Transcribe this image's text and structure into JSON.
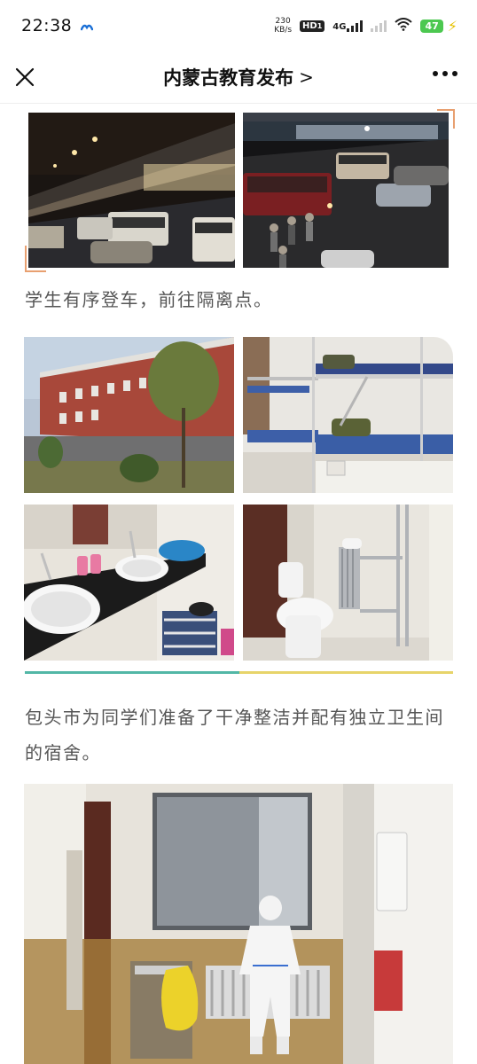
{
  "status_bar": {
    "time": "22:38",
    "net_speed_value": "230",
    "net_speed_unit": "KB/s",
    "hd_badge": "HD",
    "hd_sub": "1",
    "network_type": "4G",
    "battery": "47"
  },
  "nav": {
    "title": "内蒙古教育发布",
    "chevron": ">"
  },
  "article": {
    "caption_1": "学生有序登车，前往隔离点。",
    "caption_2": "包头市为同学们准备了干净整洁并配有独立卫生间的宿舍。"
  },
  "colors": {
    "divider_left": "#52b7a6",
    "divider_right": "#e7d46a",
    "battery": "#4cc850"
  },
  "icons": [
    "wechat-mini-icon",
    "wifi-icon",
    "charging-icon",
    "close-icon",
    "more-icon"
  ]
}
